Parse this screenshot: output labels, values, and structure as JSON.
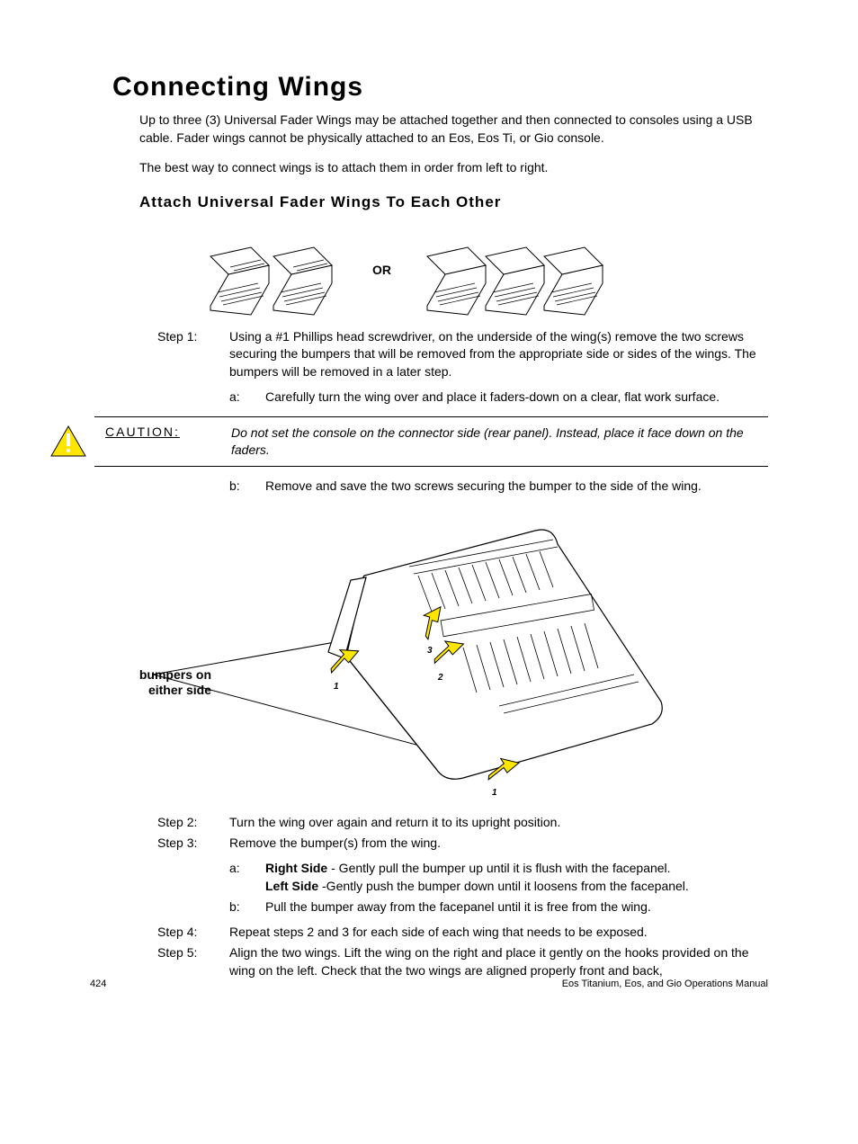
{
  "title": "Connecting Wings",
  "intro_p1": "Up to three (3) Universal Fader Wings may be attached together and then connected to consoles using a USB cable. Fader wings cannot be physically attached to an Eos, Eos Ti, or Gio console.",
  "intro_p2": "The best way to connect wings is to attach them in order from left to right.",
  "subtitle": "Attach Universal Fader Wings To Each Other",
  "or_label": "OR",
  "step1_label": "Step 1:",
  "step1_body": "Using a #1 Phillips head screwdriver, on the underside of the wing(s) remove the two screws securing the bumpers that will be removed from the appropriate side or sides of the wings. The bumpers will be removed in a later step.",
  "step1a_label": "a:",
  "step1a_body": "Carefully turn the wing over and place it faders-down on a clear, flat work surface.",
  "caution_label": "CAUTION:",
  "caution_text": "Do not set the console on the connector side (rear panel). Instead, place it face down on the faders.",
  "step1b_label": "b:",
  "step1b_body": "Remove and save the two screws securing the bumper to the side of the wing.",
  "callout": "bumpers on either side",
  "step2_label": "Step 2:",
  "step2_body": "Turn the wing over again and return it to its upright position.",
  "step3_label": "Step 3:",
  "step3_body": "Remove the bumper(s) from the wing.",
  "step3a_label": "a:",
  "step3a_right_label": "Right Side",
  "step3a_right_text": " - Gently pull the bumper up until it is flush with the facepanel.",
  "step3a_left_label": "Left Side",
  "step3a_left_text": " -Gently push the bumper down until it loosens from the facepanel.",
  "step3b_label": "b:",
  "step3b_body": "Pull the bumper away from the facepanel until it is free from the wing.",
  "step4_label": "Step 4:",
  "step4_body": "Repeat steps 2 and 3 for each side of each wing that needs to be exposed.",
  "step5_label": "Step 5:",
  "step5_body": "Align the two wings. Lift the wing on the right and place it gently on the hooks provided on the wing on the left. Check that the two wings are aligned properly front and back,",
  "page_number": "424",
  "footer_text": "Eos Titanium, Eos, and Gio Operations Manual"
}
